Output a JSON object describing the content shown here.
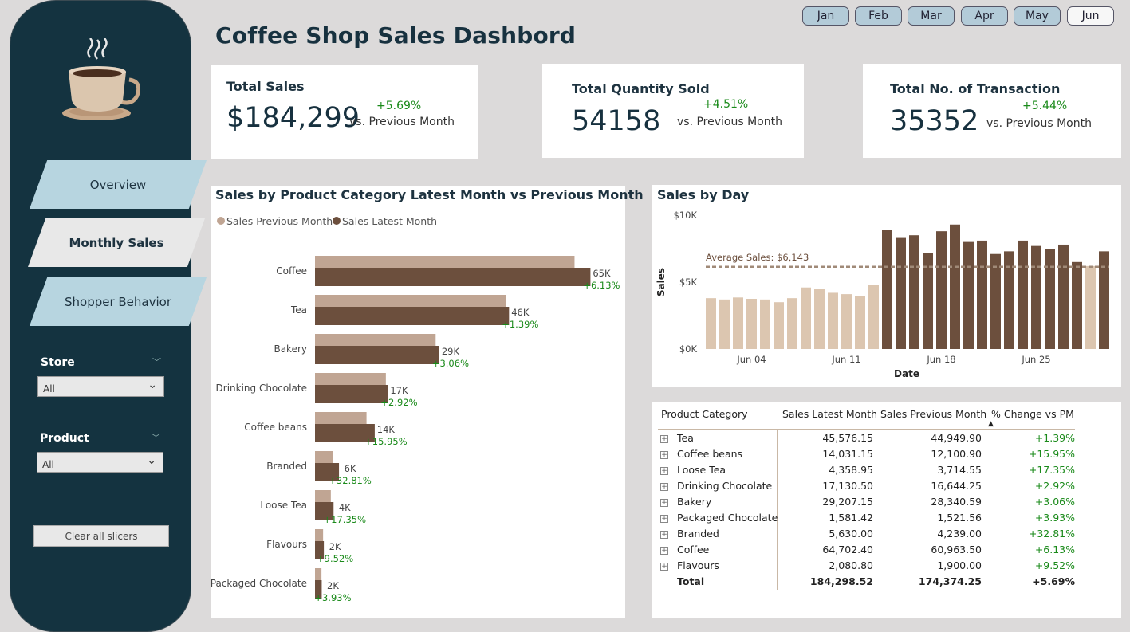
{
  "title": "Coffee Shop Sales Dashbord",
  "months": [
    {
      "label": "Jan",
      "selected": false
    },
    {
      "label": "Feb",
      "selected": false
    },
    {
      "label": "Mar",
      "selected": false
    },
    {
      "label": "Apr",
      "selected": false
    },
    {
      "label": "May",
      "selected": false
    },
    {
      "label": "Jun",
      "selected": true
    }
  ],
  "sidebar": {
    "logo_icon": "coffee-cup-icon",
    "nav": {
      "overview": "Overview",
      "monthly": "Monthly Sales",
      "shopper": "Shopper Behavior"
    },
    "active_nav": "Monthly Sales",
    "store": {
      "label": "Store",
      "value": "All"
    },
    "product": {
      "label": "Product",
      "value": "All"
    },
    "clear": "Clear all slicers"
  },
  "kpis": {
    "sales": {
      "label": "Total Sales",
      "value": "$184,299",
      "change": "+5.69%",
      "vs": "vs. Previous Month"
    },
    "qty": {
      "label": "Total Quantity Sold",
      "value": "54158",
      "change": "+4.51%",
      "vs": "vs. Previous Month"
    },
    "trans": {
      "label": "Total No. of Transaction",
      "value": "35352",
      "change": "+5.44%",
      "vs": "vs. Previous Month"
    }
  },
  "colors": {
    "previous": "#c0a593",
    "latest": "#6c4f3d",
    "light_bar": "#dcc6b0",
    "positive": "#1a8a1a",
    "sidebar": "#143340"
  },
  "chart_data": [
    {
      "type": "bar",
      "orientation": "horizontal",
      "title": "Sales by Product Category Latest Month vs Previous Month",
      "categories": [
        "Coffee",
        "Tea",
        "Bakery",
        "Drinking Chocolate",
        "Coffee beans",
        "Branded",
        "Loose Tea",
        "Flavours",
        "Packaged Chocolate"
      ],
      "series": [
        {
          "name": "Sales Previous Month",
          "values": [
            60963.5,
            44949.9,
            28340.59,
            16644.25,
            12100.9,
            4239.0,
            3714.55,
            1900.0,
            1521.56
          ]
        },
        {
          "name": "Sales Latest Month",
          "values": [
            64702.4,
            45576.15,
            29207.15,
            17130.5,
            14031.15,
            5630.0,
            4358.95,
            2080.8,
            1581.42
          ]
        }
      ],
      "value_labels": [
        "65K",
        "46K",
        "29K",
        "17K",
        "14K",
        "6K",
        "4K",
        "2K",
        "2K"
      ],
      "change_labels": [
        "+6.13%",
        "+1.39%",
        "+3.06%",
        "+2.92%",
        "+15.95%",
        "+32.81%",
        "+17.35%",
        "+9.52%",
        "+3.93%"
      ],
      "legend": "top-left"
    },
    {
      "type": "bar",
      "title": "Sales by Day",
      "xlabel": "Date",
      "ylabel": "Sales",
      "ylim": [
        0,
        10000
      ],
      "yticks": [
        "$0K",
        "$5K",
        "$10K"
      ],
      "xticks": [
        "Jun 04",
        "Jun 11",
        "Jun 18",
        "Jun 25"
      ],
      "x": [
        "Jun 01",
        "Jun 02",
        "Jun 03",
        "Jun 04",
        "Jun 05",
        "Jun 06",
        "Jun 07",
        "Jun 08",
        "Jun 09",
        "Jun 10",
        "Jun 11",
        "Jun 12",
        "Jun 13",
        "Jun 14",
        "Jun 15",
        "Jun 16",
        "Jun 17",
        "Jun 18",
        "Jun 19",
        "Jun 20",
        "Jun 21",
        "Jun 22",
        "Jun 23",
        "Jun 24",
        "Jun 25",
        "Jun 26",
        "Jun 27",
        "Jun 28",
        "Jun 29",
        "Jun 30"
      ],
      "values": [
        3800,
        3700,
        3850,
        3750,
        3700,
        3500,
        3800,
        4600,
        4500,
        4200,
        4100,
        3950,
        4800,
        8900,
        8300,
        8500,
        7200,
        8800,
        9300,
        8000,
        8100,
        7100,
        7300,
        8100,
        7700,
        7500,
        7800,
        6500,
        6200,
        7300
      ],
      "above_average": [
        false,
        false,
        false,
        false,
        false,
        false,
        false,
        false,
        false,
        false,
        false,
        false,
        false,
        true,
        true,
        true,
        true,
        true,
        true,
        true,
        true,
        true,
        true,
        true,
        true,
        true,
        true,
        true,
        false,
        true
      ],
      "average": 6143,
      "average_label": "Average Sales: $6,143"
    }
  ],
  "table": {
    "headers": [
      "Product Category",
      "Sales Latest Month",
      "Sales Previous Month",
      "% Change vs PM"
    ],
    "sort_indicator": "▲",
    "rows": [
      {
        "category": "Tea",
        "latest": "45,576.15",
        "previous": "44,949.90",
        "change": "+1.39%"
      },
      {
        "category": "Coffee beans",
        "latest": "14,031.15",
        "previous": "12,100.90",
        "change": "+15.95%"
      },
      {
        "category": "Loose Tea",
        "latest": "4,358.95",
        "previous": "3,714.55",
        "change": "+17.35%"
      },
      {
        "category": "Drinking Chocolate",
        "latest": "17,130.50",
        "previous": "16,644.25",
        "change": "+2.92%"
      },
      {
        "category": "Bakery",
        "latest": "29,207.15",
        "previous": "28,340.59",
        "change": "+3.06%"
      },
      {
        "category": "Packaged Chocolate",
        "latest": "1,581.42",
        "previous": "1,521.56",
        "change": "+3.93%"
      },
      {
        "category": "Branded",
        "latest": "5,630.00",
        "previous": "4,239.00",
        "change": "+32.81%"
      },
      {
        "category": "Coffee",
        "latest": "64,702.40",
        "previous": "60,963.50",
        "change": "+6.13%"
      },
      {
        "category": "Flavours",
        "latest": "2,080.80",
        "previous": "1,900.00",
        "change": "+9.52%"
      }
    ],
    "total": {
      "category": "Total",
      "latest": "184,298.52",
      "previous": "174,374.25",
      "change": "+5.69%"
    }
  }
}
